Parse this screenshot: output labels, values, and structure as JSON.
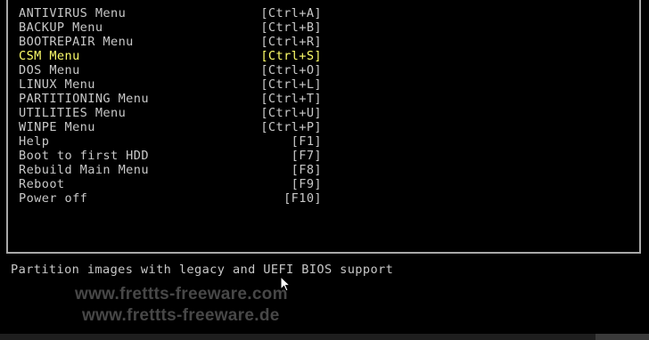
{
  "menu": {
    "items": [
      {
        "label": "ANTIVIRUS Menu",
        "hotkey": "[Ctrl+A]"
      },
      {
        "label": "BACKUP Menu",
        "hotkey": "[Ctrl+B]"
      },
      {
        "label": "BOOTREPAIR Menu",
        "hotkey": "[Ctrl+R]"
      },
      {
        "label": "CSM Menu",
        "hotkey": "[Ctrl+S]"
      },
      {
        "label": "DOS Menu",
        "hotkey": "[Ctrl+O]"
      },
      {
        "label": "LINUX Menu",
        "hotkey": "[Ctrl+L]"
      },
      {
        "label": "PARTITIONING Menu",
        "hotkey": "[Ctrl+T]"
      },
      {
        "label": "UTILITIES Menu",
        "hotkey": "[Ctrl+U]"
      },
      {
        "label": "WINPE Menu",
        "hotkey": "[Ctrl+P]"
      },
      {
        "label": "Help",
        "hotkey": "[F1]"
      },
      {
        "label": "Boot to first HDD",
        "hotkey": "[F7]"
      },
      {
        "label": "Rebuild Main Menu",
        "hotkey": "[F8]"
      },
      {
        "label": "Reboot",
        "hotkey": "[F9]"
      },
      {
        "label": "Power off",
        "hotkey": "[F10]"
      }
    ],
    "selected_index": 3
  },
  "status": {
    "text": "Partition images with legacy and UEFI BIOS support"
  },
  "watermark": {
    "line1": "www.frettts-freeware.com",
    "line2": "www.frettts-freeware.de"
  },
  "colors": {
    "background": "#000000",
    "text": "#c8c8c8",
    "selected_text": "#ffff6a",
    "frame": "#a8a8a8"
  },
  "icons": {
    "cursor": "mouse-pointer-icon"
  }
}
